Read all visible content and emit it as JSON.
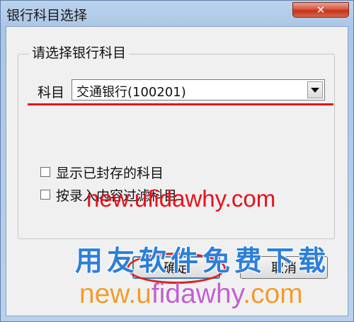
{
  "window": {
    "title": "银行科目选择",
    "close_icon": "close-icon"
  },
  "group": {
    "title": "请选择银行科目"
  },
  "account_field": {
    "label": "科目",
    "value": "交通银行(100201)"
  },
  "options": [
    {
      "label": "显示已封存的科目",
      "checked": false
    },
    {
      "label": "按录入内容过滤科目",
      "checked": false
    }
  ],
  "buttons": {
    "ok": "确定",
    "cancel": "取消"
  },
  "watermarks": {
    "url_red": "new.ufidawhy.com",
    "slogan": "用友软件免费下载",
    "url_gradient_part1": "new.u",
    "url_gradient_part2": "fidawhy",
    "url_gradient_part3": ".com"
  },
  "colors": {
    "annotation_red": "#e8101c",
    "slogan_blue": "#2d7fd8"
  }
}
